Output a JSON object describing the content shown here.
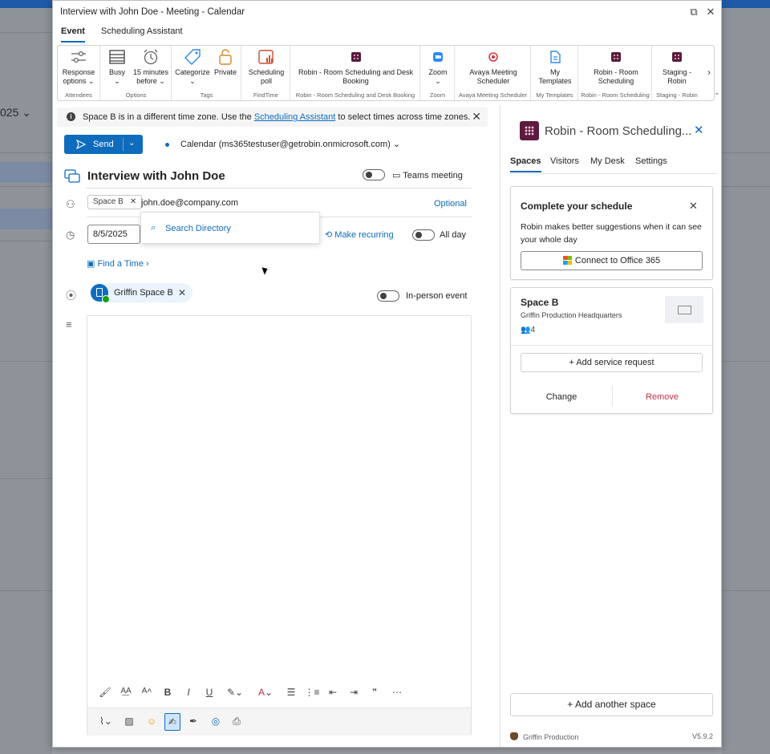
{
  "window": {
    "title": "Interview with John Doe - Meeting - Calendar"
  },
  "background": {
    "year_fragment": "025"
  },
  "tabs": [
    {
      "label": "Event"
    },
    {
      "label": "Scheduling Assistant"
    }
  ],
  "ribbon": {
    "groups": [
      {
        "label": "Attendees",
        "buttons": [
          {
            "label": "Response options"
          }
        ]
      },
      {
        "label": "Options",
        "buttons": [
          {
            "label": "Busy"
          },
          {
            "label": "15 minutes before"
          }
        ]
      },
      {
        "label": "Tags",
        "buttons": [
          {
            "label": "Categorize"
          },
          {
            "label": "Private"
          }
        ]
      },
      {
        "label": "FindTime",
        "buttons": [
          {
            "label": "Scheduling poll"
          }
        ]
      },
      {
        "label": "Robin - Room Scheduling and Desk Booking",
        "buttons": [
          {
            "label": "Robin - Room Scheduling and Desk Booking"
          }
        ]
      },
      {
        "label": "Zoom",
        "buttons": [
          {
            "label": "Zoom"
          }
        ]
      },
      {
        "label": "Avaya Meeting Scheduler",
        "buttons": [
          {
            "label": "Avaya Meeting Scheduler"
          }
        ]
      },
      {
        "label": "My Templates",
        "buttons": [
          {
            "label": "My Templates"
          }
        ]
      },
      {
        "label": "Robin - Room Scheduling",
        "buttons": [
          {
            "label": "Robin - Room Scheduling"
          }
        ]
      },
      {
        "label": "Staging - Robin",
        "buttons": [
          {
            "label": "Staging - Robin"
          }
        ]
      }
    ]
  },
  "banner": {
    "text_before": "Space B is in a different time zone. Use the ",
    "link": "Scheduling Assistant",
    "text_after": " to select times across time zones."
  },
  "compose": {
    "send_label": "Send",
    "calendar": "Calendar (ms365testuser@getrobin.onmicrosoft.com)",
    "subject": "Interview with John Doe",
    "teams_label": "Teams meeting",
    "attendee_chip": "Space B",
    "attendee_input": "john.doe@company.com",
    "optional_label": "Optional",
    "search_directory": "Search Directory",
    "date": "8/5/2025",
    "make_recurring": "Make recurring",
    "all_day": "All day",
    "find_time": "Find a Time",
    "location": "Griffin Space B",
    "in_person": "In-person event"
  },
  "robin": {
    "title": "Robin - Room Scheduling...",
    "tabs": [
      {
        "label": "Spaces"
      },
      {
        "label": "Visitors"
      },
      {
        "label": "My Desk"
      },
      {
        "label": "Settings"
      }
    ],
    "schedule_card": {
      "title": "Complete your schedule",
      "text": "Robin makes better suggestions when it can see your whole day",
      "button": "Connect to Office 365"
    },
    "space_card": {
      "name": "Space B",
      "location": "Griffin Production Headquarters",
      "capacity": "4",
      "service_button": "+ Add service request",
      "change": "Change",
      "remove": "Remove"
    },
    "add_space": "+ Add another space",
    "footer_org": "Griffin Production",
    "version": "V5.9.2"
  }
}
